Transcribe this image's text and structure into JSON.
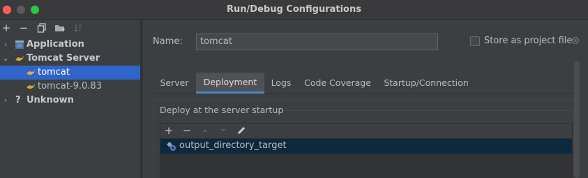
{
  "window": {
    "title": "Run/Debug Configurations"
  },
  "left_toolbar": {
    "add_icon": "plus-icon",
    "remove_icon": "minus-icon",
    "copy_icon": "copy-icon",
    "folder_icon": "new-folder-icon",
    "sort_icon": "sort-icon"
  },
  "tree": {
    "items": [
      {
        "label": "Application",
        "bold": true,
        "expanded": false,
        "icon": "application-icon"
      },
      {
        "label": "Tomcat Server",
        "bold": true,
        "expanded": true,
        "icon": "tomcat-icon"
      },
      {
        "label": "tomcat",
        "bold": false,
        "selected": true,
        "icon": "tomcat-icon"
      },
      {
        "label": "tomcat-9.0.83",
        "bold": false,
        "icon": "tomcat-icon"
      },
      {
        "label": "Unknown",
        "bold": true,
        "expanded": false,
        "icon": "question-icon"
      }
    ]
  },
  "config": {
    "name_label": "Name:",
    "name_value": "tomcat",
    "store_label": "Store as project file",
    "store_checked": false
  },
  "tabs": [
    {
      "label": "Server",
      "active": false
    },
    {
      "label": "Deployment",
      "active": true
    },
    {
      "label": "Logs",
      "active": false
    },
    {
      "label": "Code Coverage",
      "active": false
    },
    {
      "label": "Startup/Connection",
      "active": false
    }
  ],
  "deployment": {
    "group_title": "Deploy at the server startup",
    "artifacts": [
      {
        "label": "output_directory_target",
        "icon": "artifact-icon",
        "selected": true
      }
    ]
  },
  "colors": {
    "selection": "#2f65ca",
    "tab_underline": "#4a88c7",
    "list_selection": "#0d293e"
  }
}
